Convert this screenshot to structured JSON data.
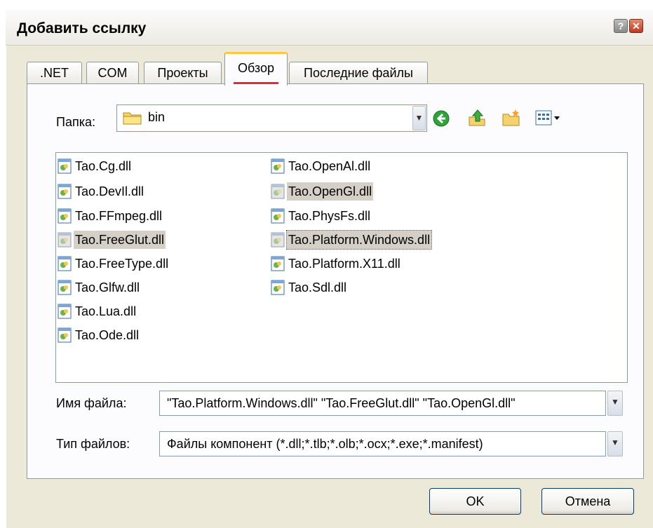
{
  "window": {
    "title": "Добавить ссылку"
  },
  "tabs": [
    ".NET",
    "COM",
    "Проекты",
    "Обзор",
    "Последние файлы"
  ],
  "folder": {
    "label": "Папка:",
    "value": "bin"
  },
  "files_col1": [
    "Tao.Cg.dll",
    "Tao.DevIl.dll",
    "Tao.FFmpeg.dll",
    "Tao.FreeGlut.dll",
    "Tao.FreeType.dll",
    "Tao.Glfw.dll",
    "Tao.Lua.dll",
    "Tao.Ode.dll"
  ],
  "files_col2": [
    "Tao.OpenAl.dll",
    "Tao.OpenGl.dll",
    "Tao.PhysFs.dll",
    "Tao.Platform.Windows.dll",
    "Tao.Platform.X11.dll",
    "Tao.Sdl.dll"
  ],
  "filename": {
    "label": "Имя файла:",
    "value": "\"Tao.Platform.Windows.dll\" \"Tao.FreeGlut.dll\" \"Tao.OpenGl.dll\""
  },
  "filetype": {
    "label": "Тип файлов:",
    "value": "Файлы компонент (*.dll;*.tlb;*.olb;*.ocx;*.exe;*.manifest)"
  },
  "buttons": {
    "ok": "OK",
    "cancel": "Отмена"
  },
  "colors": {
    "accent_tab": "#ffc83c",
    "tab_underline": "#e5283a",
    "selection": "#d4d0c8"
  }
}
